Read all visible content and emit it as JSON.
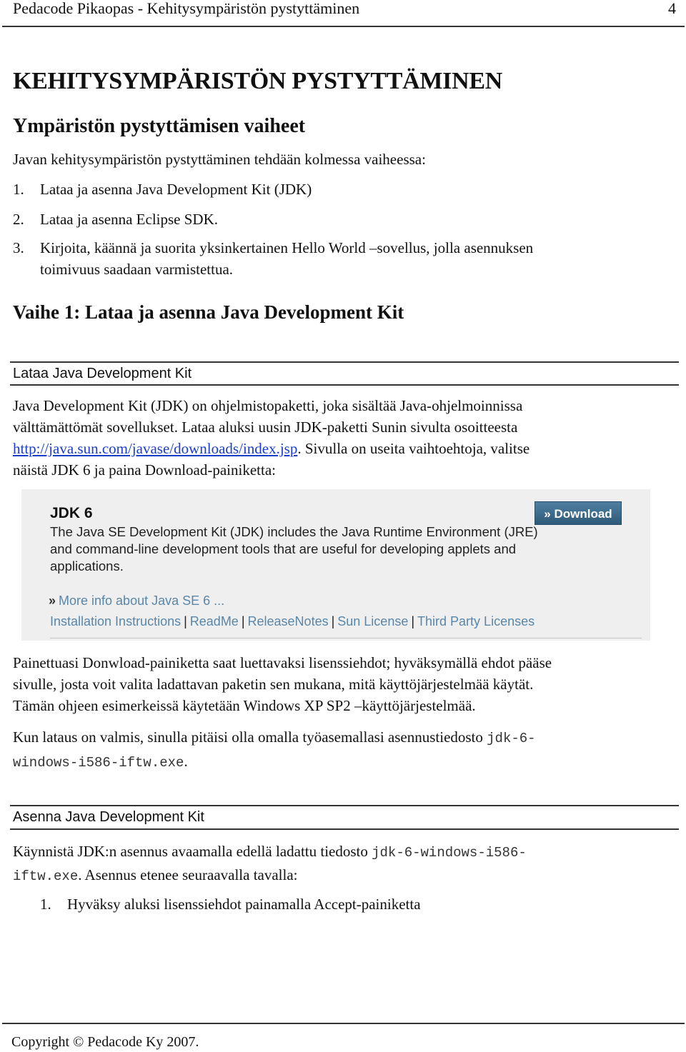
{
  "header": {
    "title": "Pedacode Pikaopas - Kehitysympäristön pystyttäminen",
    "page_number": "4"
  },
  "heading_main": "KEHITYSYMPÄRISTÖN PYSTYTTÄMINEN",
  "heading_phases": "Ympäristön pystyttämisen vaiheet",
  "intro": "Javan kehitysympäristön pystyttäminen tehdään kolmessa vaiheessa:",
  "steps": [
    {
      "num": "1.",
      "text": "Lataa ja asenna Java Development Kit (JDK)"
    },
    {
      "num": "2.",
      "text": "Lataa ja asenna Eclipse SDK."
    },
    {
      "num": "3.",
      "text_line1": "Kirjoita, käännä ja suorita yksinkertainen Hello World –sovellus, jolla asennuksen",
      "text_line2": "toimivuus saadaan varmistettua."
    }
  ],
  "phase1_heading": "Vaihe 1: Lataa ja asenna Java Development Kit",
  "section_download": {
    "title": "Lataa Java Development Kit",
    "line1": "Java Development Kit (JDK) on ohjelmistopaketti, joka sisältää Java-ohjelmoinnissa",
    "line2": "välttämättömät sovellukset. Lataa aluksi uusin JDK-paketti Sunin sivulta osoitteesta",
    "link": "http://java.sun.com/javase/downloads/index.jsp",
    "line3_after_link": ". Sivulla on useita vaihtoehtoja, valitse",
    "line4": "näistä JDK 6 ja paina Download-painiketta:"
  },
  "jdk_panel": {
    "title": "JDK 6",
    "description": "The Java SE Development Kit (JDK) includes the Java Runtime Environment (JRE) and command-line development tools that are useful for developing applets and applications.",
    "download_button": "» Download",
    "more_info_prefix": "»",
    "more_info": "More info about Java SE 6 ...",
    "links": [
      "Installation Instructions",
      "ReadMe",
      "ReleaseNotes",
      "Sun License",
      "Third Party Licenses"
    ],
    "link_separator": "|",
    "colors": {
      "button": "#3d6b8c",
      "link": "#5a86a8",
      "panel_bg": "#efefef"
    }
  },
  "para_license": {
    "line1": "Painettuasi Donwload-painiketta saat luettavaksi lisenssiehdot; hyväksymällä ehdot pääse",
    "line2": "sivulle, josta voit valita ladattavan paketin sen mukana, mitä käyttöjärjestelmää käytät.",
    "line3": "Tämän ohjeen esimerkeissä käytetään Windows XP SP2 –käyttöjärjestelmää."
  },
  "para_ready": {
    "text": "Kun lataus on valmis, sinulla pitäisi olla omalla työasemallasi asennustiedosto ",
    "code_part1": "jdk-6-",
    "code_part2": "windows-i586-iftw.exe",
    "end": "."
  },
  "section_install": {
    "title": "Asenna Java Development Kit",
    "text": "Käynnistä JDK:n asennus avaamalla edellä ladattu tiedosto ",
    "code_part1": "jdk-6-windows-i586-",
    "code_part2": "iftw.exe",
    "after": ". Asennus etenee seuraavalla tavalla:",
    "steps": [
      {
        "num": "1.",
        "text": "Hyväksy aluksi lisenssiehdot painamalla Accept-painiketta"
      }
    ]
  },
  "footer": {
    "copyright": "Copyright © Pedacode Ky 2007."
  },
  "colors": {
    "link": "#1a3ec8",
    "rule": "#333333"
  }
}
